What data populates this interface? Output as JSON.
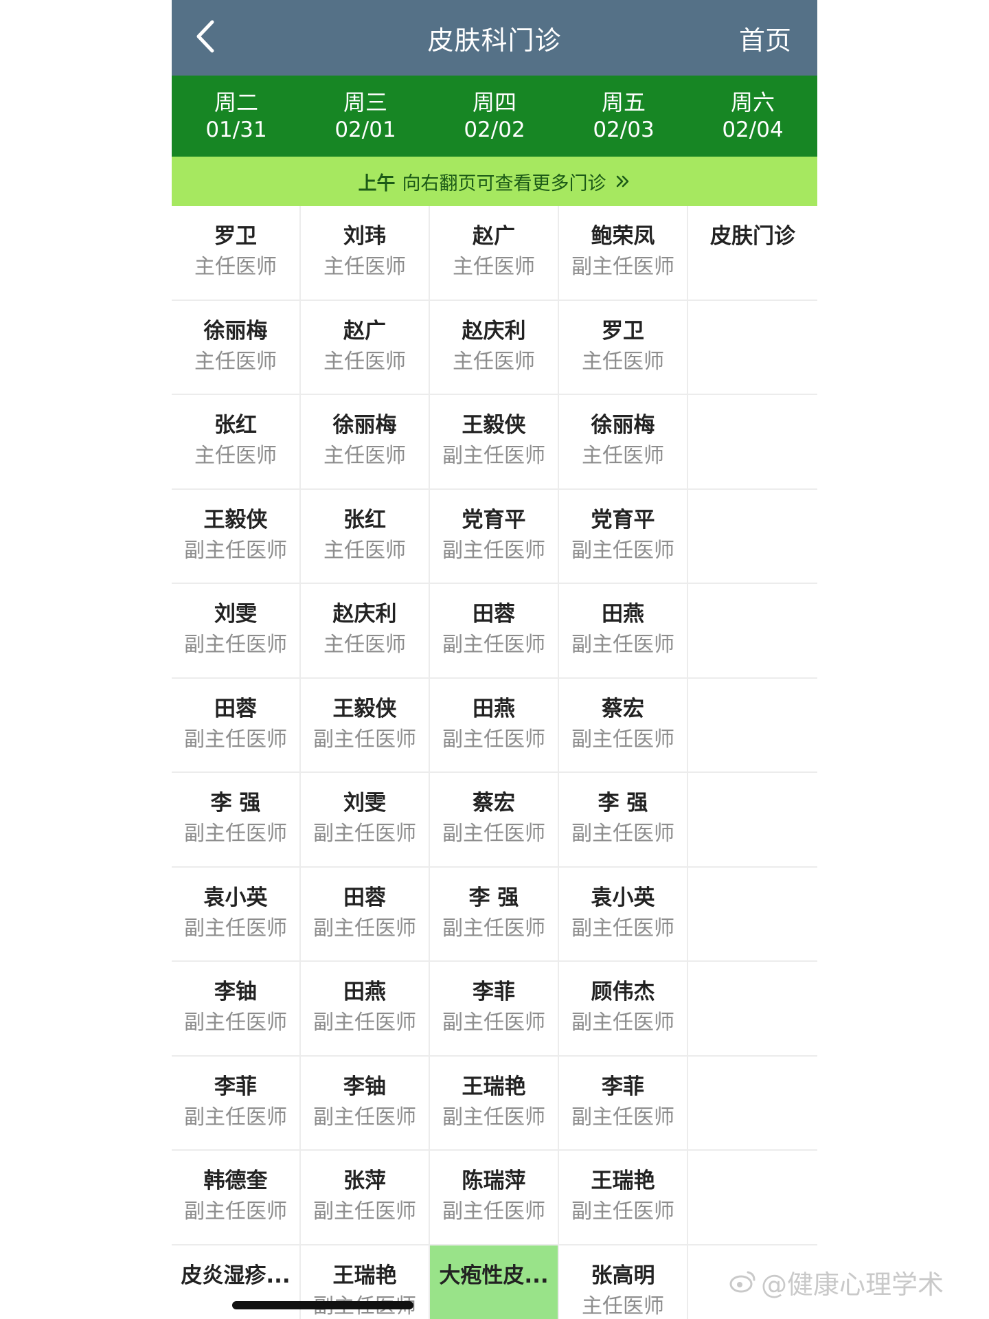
{
  "header": {
    "title": "皮肤科门诊",
    "home_label": "首页"
  },
  "days": [
    {
      "weekday": "周二",
      "date": "01/31"
    },
    {
      "weekday": "周三",
      "date": "02/01"
    },
    {
      "weekday": "周四",
      "date": "02/02"
    },
    {
      "weekday": "周五",
      "date": "02/03"
    },
    {
      "weekday": "周六",
      "date": "02/04"
    }
  ],
  "hint": {
    "period": "上午",
    "text": "向右翻页可查看更多门诊"
  },
  "schedule": [
    [
      {
        "name": "罗卫",
        "title": "主任医师"
      },
      {
        "name": "刘玮",
        "title": "主任医师"
      },
      {
        "name": "赵广",
        "title": "主任医师"
      },
      {
        "name": "鲍荣凤",
        "title": "副主任医师"
      },
      {
        "name": "皮肤门诊",
        "title": ""
      }
    ],
    [
      {
        "name": "徐丽梅",
        "title": "主任医师"
      },
      {
        "name": "赵广",
        "title": "主任医师"
      },
      {
        "name": "赵庆利",
        "title": "主任医师"
      },
      {
        "name": "罗卫",
        "title": "主任医师"
      },
      {
        "name": "",
        "title": ""
      }
    ],
    [
      {
        "name": "张红",
        "title": "主任医师"
      },
      {
        "name": "徐丽梅",
        "title": "主任医师"
      },
      {
        "name": "王毅侠",
        "title": "副主任医师"
      },
      {
        "name": "徐丽梅",
        "title": "主任医师"
      },
      {
        "name": "",
        "title": ""
      }
    ],
    [
      {
        "name": "王毅侠",
        "title": "副主任医师"
      },
      {
        "name": "张红",
        "title": "主任医师"
      },
      {
        "name": "党育平",
        "title": "副主任医师"
      },
      {
        "name": "党育平",
        "title": "副主任医师"
      },
      {
        "name": "",
        "title": ""
      }
    ],
    [
      {
        "name": "刘雯",
        "title": "副主任医师"
      },
      {
        "name": "赵庆利",
        "title": "主任医师"
      },
      {
        "name": "田蓉",
        "title": "副主任医师"
      },
      {
        "name": "田燕",
        "title": "副主任医师"
      },
      {
        "name": "",
        "title": ""
      }
    ],
    [
      {
        "name": "田蓉",
        "title": "副主任医师"
      },
      {
        "name": "王毅侠",
        "title": "副主任医师"
      },
      {
        "name": "田燕",
        "title": "副主任医师"
      },
      {
        "name": "蔡宏",
        "title": "副主任医师"
      },
      {
        "name": "",
        "title": ""
      }
    ],
    [
      {
        "name": "李 强",
        "title": "副主任医师"
      },
      {
        "name": "刘雯",
        "title": "副主任医师"
      },
      {
        "name": "蔡宏",
        "title": "副主任医师"
      },
      {
        "name": "李 强",
        "title": "副主任医师"
      },
      {
        "name": "",
        "title": ""
      }
    ],
    [
      {
        "name": "袁小英",
        "title": "副主任医师"
      },
      {
        "name": "田蓉",
        "title": "副主任医师"
      },
      {
        "name": "李 强",
        "title": "副主任医师"
      },
      {
        "name": "袁小英",
        "title": "副主任医师"
      },
      {
        "name": "",
        "title": ""
      }
    ],
    [
      {
        "name": "李铀",
        "title": "副主任医师"
      },
      {
        "name": "田燕",
        "title": "副主任医师"
      },
      {
        "name": "李菲",
        "title": "副主任医师"
      },
      {
        "name": "顾伟杰",
        "title": "副主任医师"
      },
      {
        "name": "",
        "title": ""
      }
    ],
    [
      {
        "name": "李菲",
        "title": "副主任医师"
      },
      {
        "name": "李铀",
        "title": "副主任医师"
      },
      {
        "name": "王瑞艳",
        "title": "副主任医师"
      },
      {
        "name": "李菲",
        "title": "副主任医师"
      },
      {
        "name": "",
        "title": ""
      }
    ],
    [
      {
        "name": "韩德奎",
        "title": "副主任医师"
      },
      {
        "name": "张萍",
        "title": "副主任医师"
      },
      {
        "name": "陈瑞萍",
        "title": "副主任医师"
      },
      {
        "name": "王瑞艳",
        "title": "副主任医师"
      },
      {
        "name": "",
        "title": ""
      }
    ],
    [
      {
        "name": "皮炎湿疹...",
        "title": ""
      },
      {
        "name": "王瑞艳",
        "title": "副主任医师"
      },
      {
        "name": "大疱性皮...",
        "title": "",
        "highlight": true
      },
      {
        "name": "张高明",
        "title": "主任医师"
      },
      {
        "name": "",
        "title": ""
      }
    ]
  ],
  "watermark": "@健康心理学术",
  "colors": {
    "navbar": "#557187",
    "day_bar": "#178624",
    "hint_bar": "#a6e860",
    "highlight_cell": "#99e389"
  },
  "icons": {
    "back": "chevron-left-icon",
    "hint_arrow": "double-chevron-right-icon"
  }
}
